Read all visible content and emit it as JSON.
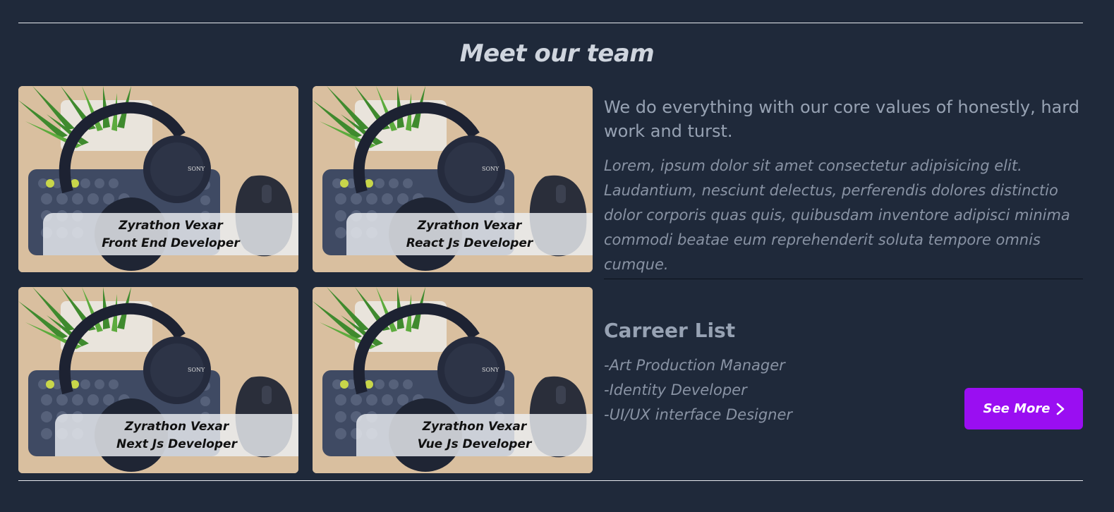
{
  "section_title": "Meet our team",
  "team": [
    {
      "name": "Zyrathon Vexar",
      "role": "Front End Developer"
    },
    {
      "name": "Zyrathon Vexar",
      "role": "React Js Developer"
    },
    {
      "name": "Zyrathon Vexar",
      "role": "Next Js Developer"
    },
    {
      "name": "Zyrathon Vexar",
      "role": "Vue Js Developer"
    }
  ],
  "values": {
    "lead": "We do everything with our core values of honestly, hard work and turst.",
    "paragraph": "Lorem, ipsum dolor sit amet consectetur adipisicing elit. Laudantium, nesciunt delectus, perferendis dolores distinctio dolor corporis quas quis, quibusdam inventore adipisci minima commodi beatae eum reprehenderit soluta tempore omnis cumque."
  },
  "career": {
    "title": "Carreer List",
    "items": [
      "-Art Production Manager",
      "-Identity Developer",
      "-UI/UX interface Designer"
    ],
    "button_label": "See More",
    "button_icon": "chevron-right-icon"
  },
  "colors": {
    "background": "#1f293a",
    "accent": "#9a0ef2"
  }
}
